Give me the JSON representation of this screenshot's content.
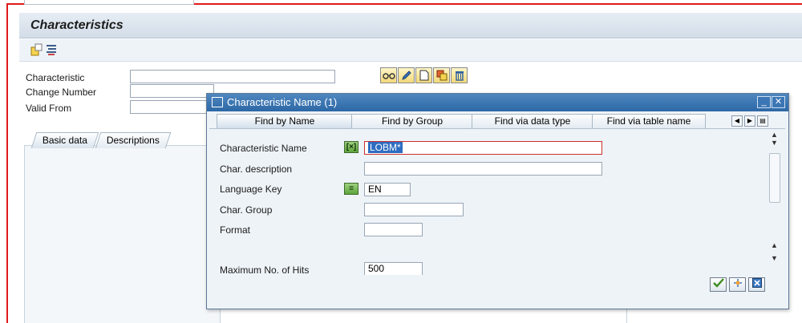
{
  "main": {
    "title": "Characteristics",
    "fields": {
      "characteristic_label": "Characteristic",
      "characteristic_value": "",
      "change_number_label": "Change Number",
      "change_number_value": "",
      "valid_from_label": "Valid From",
      "valid_from_value": ""
    },
    "tabs": [
      {
        "label": "Basic data"
      },
      {
        "label": "Descriptions"
      }
    ]
  },
  "dialog": {
    "title": "Characteristic Name (1)",
    "tabs": [
      {
        "label": "Find by Name"
      },
      {
        "label": "Find by Group"
      },
      {
        "label": "Find via data type"
      },
      {
        "label": "Find via table name"
      }
    ],
    "fields": {
      "char_name_label": "Characteristic Name",
      "char_name_value": "LOBM*",
      "char_name_selop": "[×]",
      "char_desc_label": "Char. description",
      "char_desc_value": "",
      "lang_key_label": "Language Key",
      "lang_key_value": "EN",
      "lang_key_selop": "=",
      "char_group_label": "Char. Group",
      "char_group_value": "",
      "format_label": "Format",
      "format_value": "",
      "max_hits_label": "Maximum No. of Hits",
      "max_hits_value": "500"
    }
  },
  "colors": {
    "frame_red": "#e01a1a",
    "dialog_title": "#2d68a6",
    "selop_green": "#5ea43b"
  }
}
